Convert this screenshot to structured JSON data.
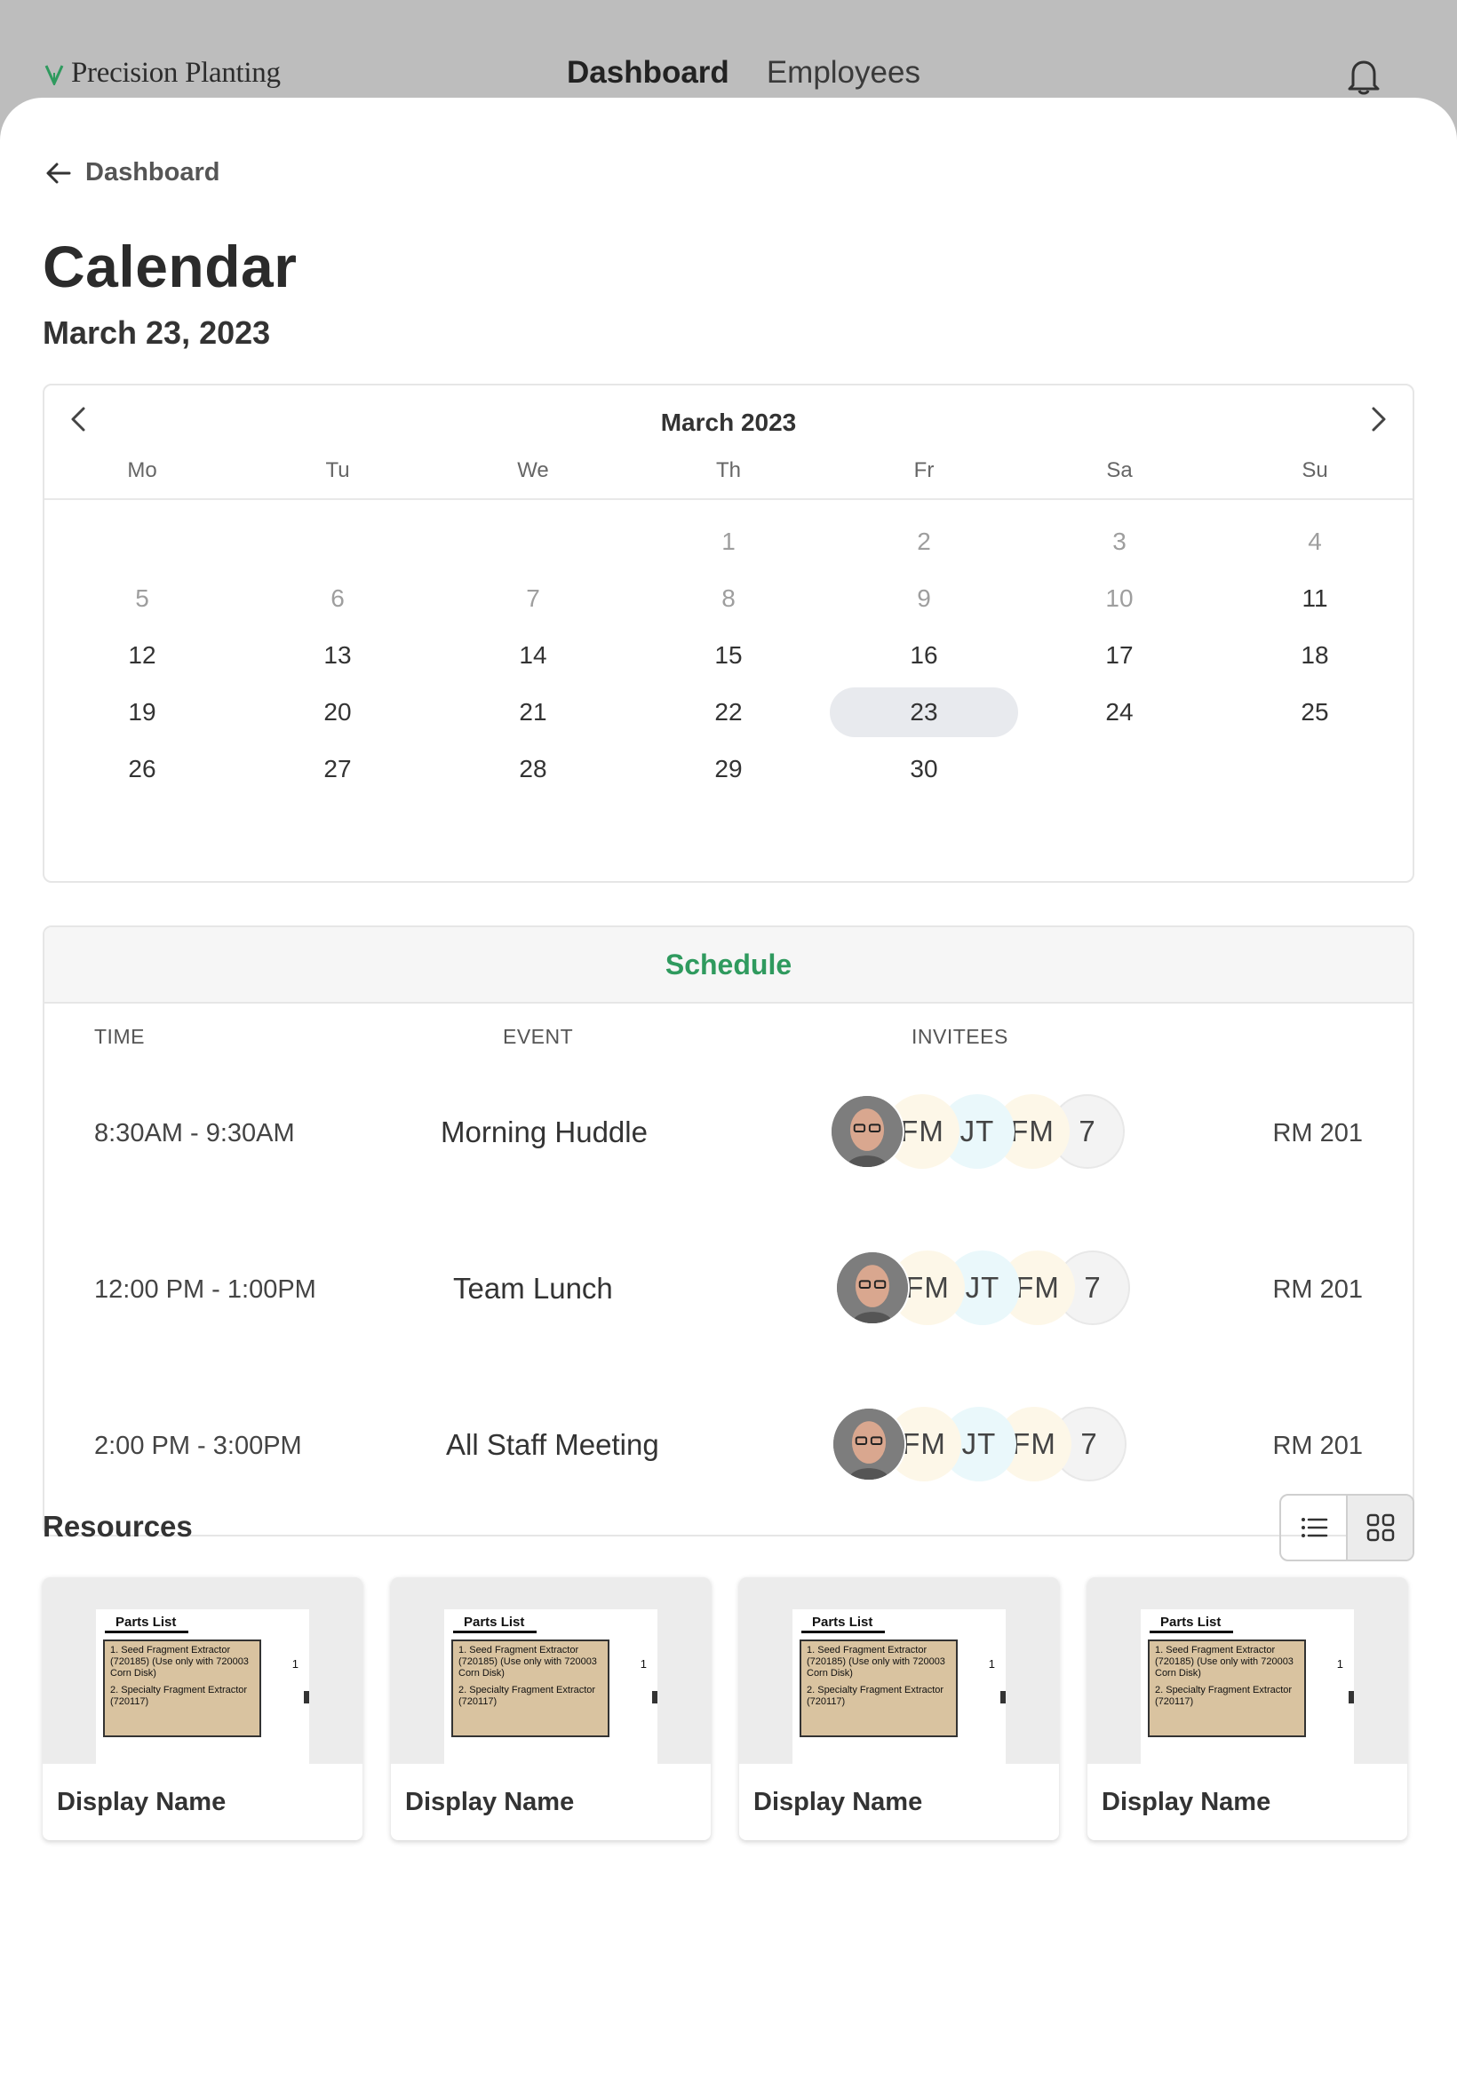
{
  "brand": {
    "name": "Precision Planting",
    "color": "#2f9a5e"
  },
  "nav": {
    "items": [
      "Dashboard",
      "Employees"
    ],
    "active": "Dashboard"
  },
  "back": {
    "label": "Dashboard"
  },
  "page": {
    "title": "Calendar",
    "date": "March 23, 2023"
  },
  "calendar": {
    "month_label": "March 2023",
    "weekdays": [
      "Mo",
      "Tu",
      "We",
      "Th",
      "Fr",
      "Sa",
      "Su"
    ],
    "weeks": [
      [
        "",
        "",
        "",
        "1",
        "2",
        "3",
        "4"
      ],
      [
        "5",
        "6",
        "7",
        "8",
        "9",
        "10",
        "11"
      ],
      [
        "12",
        "13",
        "14",
        "15",
        "16",
        "17",
        "18"
      ],
      [
        "19",
        "20",
        "21",
        "22",
        "23",
        "24",
        "25"
      ],
      [
        "26",
        "27",
        "28",
        "29",
        "30",
        "",
        ""
      ]
    ],
    "muted_days": [
      "1",
      "2",
      "3",
      "4",
      "5",
      "6",
      "7",
      "8",
      "9",
      "10"
    ],
    "selected_day": "23"
  },
  "schedule": {
    "title": "Schedule",
    "columns": {
      "time": "TIME",
      "event": "EVENT",
      "invitees": "INVITEES"
    },
    "rows": [
      {
        "time": "8:30AM - 9:30AM",
        "event": "Morning Huddle",
        "invitees": [
          "FM",
          "JT",
          "FM"
        ],
        "more": "7",
        "room": "RM 201"
      },
      {
        "time": "12:00 PM - 1:00PM",
        "event": "Team Lunch",
        "invitees": [
          "FM",
          "JT",
          "FM"
        ],
        "more": "7",
        "room": "RM 201"
      },
      {
        "time": "2:00 PM - 3:00PM",
        "event": "All Staff Meeting",
        "invitees": [
          "FM",
          "JT",
          "FM"
        ],
        "more": "7",
        "room": "RM 201"
      }
    ]
  },
  "resources": {
    "title": "Resources",
    "view_mode": "grid",
    "cards": [
      {
        "name": "Display Name",
        "doc_title": "Parts List",
        "doc_items": [
          "1.   Seed Fragment Extractor (720185) (Use only with 720003 Corn Disk)",
          "2.   Specialty Fragment Extractor (720117)"
        ],
        "doc_number": "1"
      },
      {
        "name": "Display Name",
        "doc_title": "Parts List",
        "doc_items": [
          "1.   Seed Fragment Extractor (720185) (Use only with 720003 Corn Disk)",
          "2.   Specialty Fragment Extractor (720117)"
        ],
        "doc_number": "1"
      },
      {
        "name": "Display Name",
        "doc_title": "Parts List",
        "doc_items": [
          "1.   Seed Fragment Extractor (720185) (Use only with 720003 Corn Disk)",
          "2.   Specialty Fragment Extractor (720117)"
        ],
        "doc_number": "1"
      },
      {
        "name": "Display Name",
        "doc_title": "Parts List",
        "doc_items": [
          "1.   Seed Fragment Extractor (720185) (Use only with 720003 Corn Disk)",
          "2.   Specialty Fragment Extractor (720117)"
        ],
        "doc_number": "1"
      }
    ]
  },
  "icons": {
    "notifications": "bell-icon",
    "back": "arrow-left-icon",
    "prev": "chevron-left-icon",
    "next": "chevron-right-icon",
    "list_view": "list-icon",
    "grid_view": "grid-icon"
  }
}
